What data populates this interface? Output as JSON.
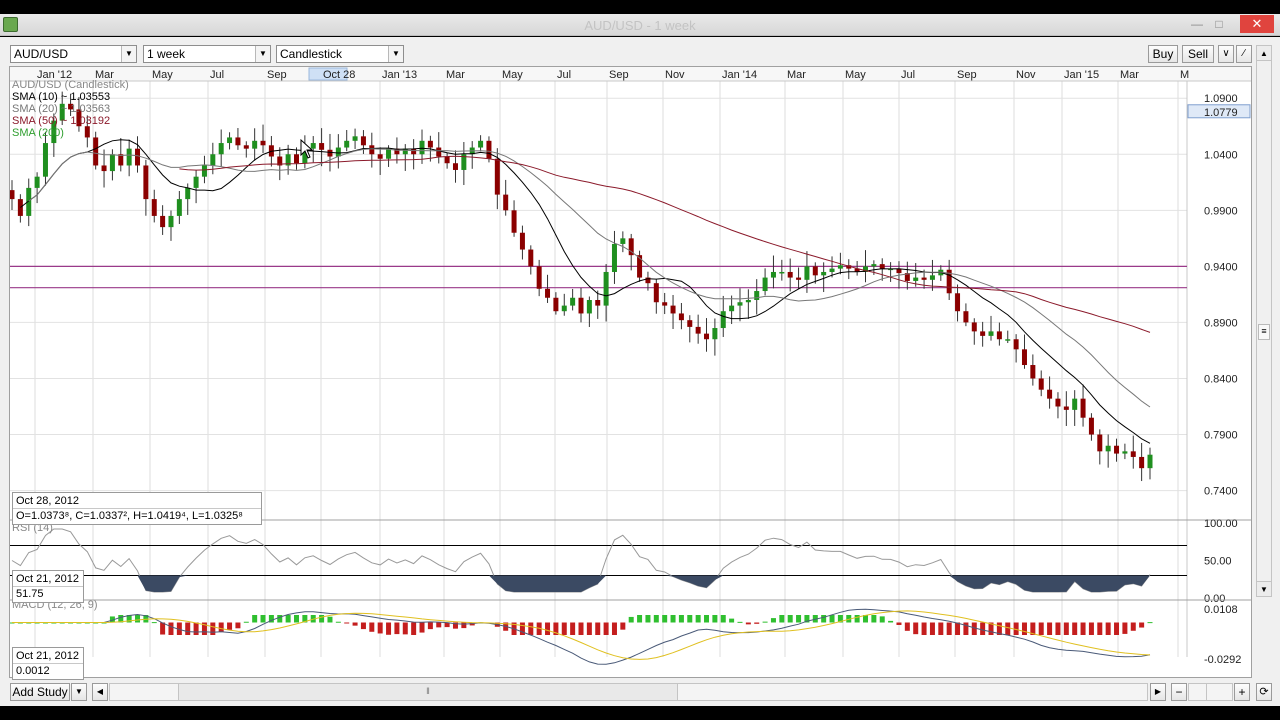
{
  "window": {
    "title": "AUD/USD - 1 week"
  },
  "toolbar": {
    "symbol": "AUD/USD",
    "interval": "1 week",
    "chart_type": "Candlestick",
    "buy_label": "Buy",
    "sell_label": "Sell"
  },
  "time_axis": [
    "Jan '12",
    "Mar",
    "May",
    "Jul",
    "Sep",
    "Oct 28",
    "Jan '13",
    "Mar",
    "May",
    "Jul",
    "Sep",
    "Nov",
    "Jan '14",
    "Mar",
    "May",
    "Jul",
    "Sep",
    "Nov",
    "Jan '15",
    "Mar",
    "M"
  ],
  "time_axis_highlight": "Oct 28",
  "legend": {
    "title": "AUD/USD (Candlestick)",
    "sma10": "SMA (10) ~ 1.03553",
    "sma20": "SMA (20) ~ 1.03563",
    "sma50": "SMA (50) ~ 1.03192",
    "sma200": "SMA (200)",
    "colors": {
      "sma10": "#000000",
      "sma20": "#777777",
      "sma50": "#8b1a2b",
      "sma200": "#2e9e2e"
    }
  },
  "price_axis": [
    "1.0900",
    "1.0400",
    "0.9900",
    "0.9400",
    "0.8900",
    "0.8400",
    "0.7900",
    "0.7400"
  ],
  "price_current": "1.0779",
  "ohlc_box": {
    "date": "Oct 28, 2012",
    "values": "O=1.0373⁸, C=1.0337², H=1.0419⁴, L=1.0325⁸"
  },
  "rsi": {
    "label": "RSI (14)",
    "axis": [
      "100.00",
      "50.00",
      "0.00"
    ],
    "box_date": "Oct 21, 2012",
    "box_value": "51.75"
  },
  "macd": {
    "label": "MACD (12, 26, 9)",
    "axis": [
      "0.0108",
      "-0.0292"
    ],
    "box_date": "Oct 21, 2012",
    "box_value": "0.0012"
  },
  "bottom": {
    "add_study_label": "Add Study"
  },
  "colors": {
    "up": "#1f8f1f",
    "down": "#8b0000",
    "hline": "#9a3a8a",
    "rsi_fill": "#3b4a63"
  },
  "series": {
    "close": [
      1.0,
      0.985,
      1.01,
      1.02,
      1.05,
      1.07,
      1.085,
      1.08,
      1.065,
      1.055,
      1.03,
      1.025,
      1.04,
      1.03,
      1.045,
      1.03,
      1.0,
      0.985,
      0.975,
      0.985,
      1.0,
      1.01,
      1.02,
      1.03,
      1.04,
      1.05,
      1.055,
      1.048,
      1.045,
      1.052,
      1.048,
      1.038,
      1.03,
      1.04,
      1.032,
      1.045,
      1.05,
      1.044,
      1.038,
      1.046,
      1.052,
      1.056,
      1.048,
      1.04,
      1.036,
      1.045,
      1.04,
      1.045,
      1.04,
      1.052,
      1.046,
      1.038,
      1.032,
      1.026,
      1.04,
      1.046,
      1.052,
      1.036,
      1.004,
      0.99,
      0.97,
      0.955,
      0.94,
      0.92,
      0.912,
      0.9,
      0.905,
      0.912,
      0.898,
      0.91,
      0.905,
      0.935,
      0.96,
      0.965,
      0.95,
      0.93,
      0.925,
      0.908,
      0.905,
      0.898,
      0.892,
      0.886,
      0.88,
      0.875,
      0.885,
      0.9,
      0.905,
      0.908,
      0.91,
      0.918,
      0.93,
      0.935,
      0.935,
      0.93,
      0.928,
      0.94,
      0.932,
      0.935,
      0.938,
      0.941,
      0.938,
      0.935,
      0.94,
      0.942,
      0.938,
      0.938,
      0.934,
      0.927,
      0.93,
      0.928,
      0.932,
      0.937,
      0.916,
      0.9,
      0.89,
      0.882,
      0.878,
      0.882,
      0.875,
      0.875,
      0.866,
      0.852,
      0.84,
      0.83,
      0.822,
      0.815,
      0.812,
      0.822,
      0.805,
      0.79,
      0.775,
      0.78,
      0.773,
      0.775,
      0.77,
      0.76,
      0.772
    ]
  }
}
